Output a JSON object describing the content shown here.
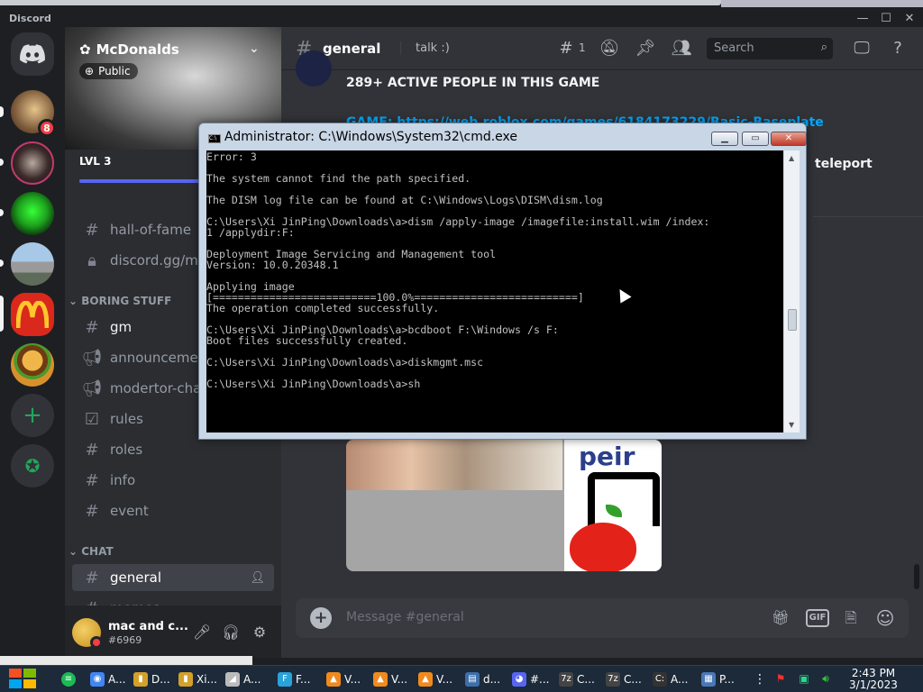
{
  "app": {
    "name": "Discord"
  },
  "server": {
    "name": "McDonalds",
    "visibility": "Public",
    "level": "LVL 3",
    "boost_progress": 0.65,
    "rail_badge": "8"
  },
  "channels": {
    "hall_of_fame": "hall-of-fame",
    "invite": "discord.gg/mcd",
    "category_boring": "BORING STUFF",
    "gm": "gm",
    "announcements": "announcements",
    "modertor_chat": "modertor-chat",
    "rules": "rules",
    "roles": "roles",
    "info": "info",
    "event": "event",
    "category_chat": "CHAT",
    "general": "general",
    "memes": "memes"
  },
  "user": {
    "name": "mac and c...",
    "tag": "#6969"
  },
  "header": {
    "channel": "general",
    "topic": "talk :)",
    "threads_count": "1",
    "search_placeholder": "Search"
  },
  "messages": {
    "headline": "289+ ACTIVE PEOPLE IN THIS GAME",
    "game_line": "GAME: https://web.roblox.com/games/6184173229/Basic-Baseplate",
    "teleport": "teleport",
    "image_text": "peir"
  },
  "composer": {
    "placeholder": "Message #general",
    "gif_label": "GIF"
  },
  "cmd": {
    "title": "Administrator: C:\\Windows\\System32\\cmd.exe",
    "lines": [
      "Error: 3",
      "",
      "The system cannot find the path specified.",
      "",
      "The DISM log file can be found at C:\\Windows\\Logs\\DISM\\dism.log",
      "",
      "C:\\Users\\Xi JinPing\\Downloads\\a>dism /apply-image /imagefile:install.wim /index:",
      "1 /applydir:F:",
      "",
      "Deployment Image Servicing and Management tool",
      "Version: 10.0.20348.1",
      "",
      "Applying image",
      "[==========================100.0%==========================]",
      "The operation completed successfully.",
      "",
      "C:\\Users\\Xi JinPing\\Downloads\\a>bcdboot F:\\Windows /s F:",
      "Boot files successfully created.",
      "",
      "C:\\Users\\Xi JinPing\\Downloads\\a>diskmgmt.msc",
      "",
      "C:\\Users\\Xi JinPing\\Downloads\\a>sh"
    ]
  },
  "taskbar": {
    "items": [
      "A...",
      "D...",
      "Xi...",
      "A...",
      "F...",
      "V...",
      "V...",
      "V...",
      "d...",
      "#...",
      "C...",
      "C...",
      "A...",
      "P..."
    ],
    "time": "2:43 PM",
    "date": "3/1/2023"
  },
  "colors": {
    "discord_bg": "#313338",
    "sidebar_bg": "#2b2d31",
    "rail_bg": "#1e1f22",
    "accent": "#5865f2",
    "link": "#00a8fc",
    "danger": "#f23f43",
    "console_bg": "#000000",
    "console_fg": "#c0c0c0"
  }
}
